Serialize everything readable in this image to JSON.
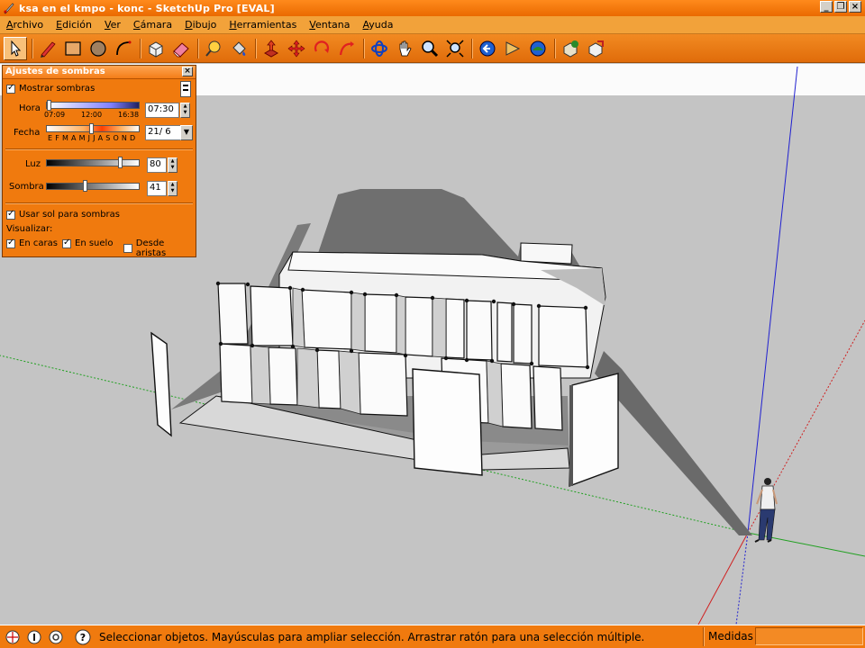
{
  "window": {
    "title": "ksa en el kmpo - konc - SketchUp Pro [EVAL]",
    "app_icon": "sketchup-icon",
    "controls": [
      "minimize",
      "restore",
      "close"
    ]
  },
  "menu": [
    "Archivo",
    "Edición",
    "Ver",
    "Cámara",
    "Dibujo",
    "Herramientas",
    "Ventana",
    "Ayuda"
  ],
  "toolbar": {
    "tools": [
      "select-icon",
      "pencil-icon",
      "rectangle-icon",
      "circle-icon",
      "arc-icon",
      "make-component-icon",
      "eraser-icon",
      "tape-measure-icon",
      "paint-bucket-icon",
      "push-pull-icon",
      "move-icon",
      "rotate-icon",
      "follow-me-icon",
      "orbit-icon",
      "pan-icon",
      "zoom-icon",
      "zoom-extents-icon",
      "previous-view-icon",
      "next-view-icon",
      "get-models-icon",
      "share-model-icon",
      "share-component-icon",
      "components-icon"
    ],
    "active": "select-icon"
  },
  "shadow_panel": {
    "title": "Ajustes de sombras",
    "show_shadows": {
      "label": "Mostrar sombras",
      "checked": true
    },
    "hora": {
      "label": "Hora",
      "ticks": [
        "07:09",
        "12:00",
        "16:38"
      ],
      "value": "07:30"
    },
    "fecha": {
      "label": "Fecha",
      "months": "E F M A M J J A S O N D",
      "value": "21/ 6"
    },
    "luz": {
      "label": "Luz",
      "value": "80",
      "level": 0.8
    },
    "sombra": {
      "label": "Sombra",
      "value": "41",
      "level": 0.41
    },
    "use_sun": {
      "label": "Usar sol para sombras",
      "checked": true
    },
    "visualizar": "Visualizar:",
    "en_caras": {
      "label": "En caras",
      "checked": true
    },
    "en_suelo": {
      "label": "En suelo",
      "checked": true
    },
    "desde_aristas": {
      "label": "Desde aristas",
      "checked": false
    }
  },
  "status": {
    "icons": [
      "geo-location-icon",
      "credits-icon",
      "sign-in-icon",
      "help-icon"
    ],
    "message": "Seleccionar objetos. Mayúsculas para ampliar selección. Arrastrar ratón para una selección múltiple.",
    "measure_label": "Medidas",
    "measure_value": ""
  },
  "colors": {
    "accent": "#f07a0e",
    "sky": "#fafafa",
    "ground": "#c4c4c4",
    "axis_red": "#d02020",
    "axis_green": "#20a020",
    "axis_blue": "#2020d0"
  }
}
